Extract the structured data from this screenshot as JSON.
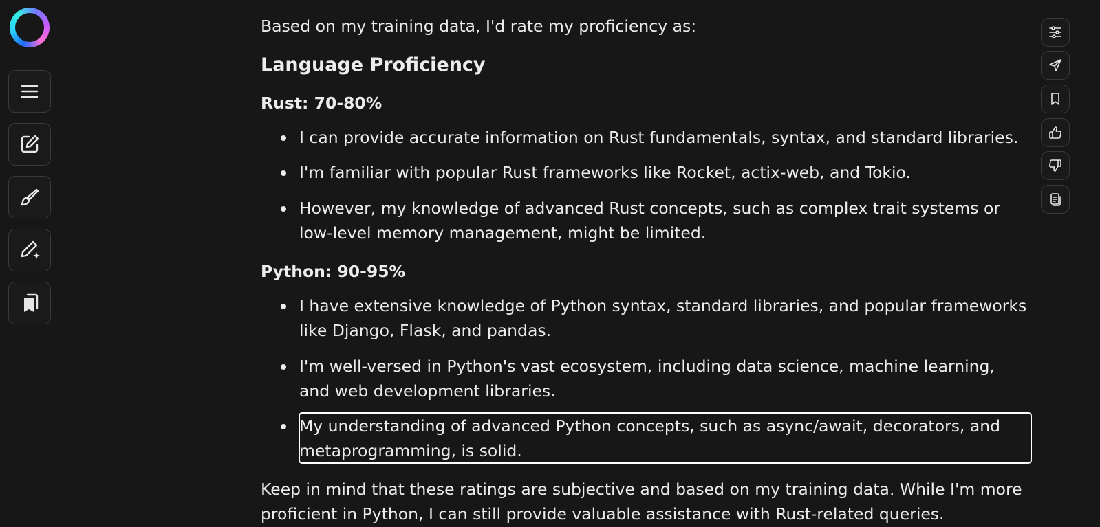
{
  "sidebar": {
    "logo_icon": "assistant-ring-logo",
    "buttons": [
      {
        "icon": "menu-icon",
        "name": "menu"
      },
      {
        "icon": "new-chat-icon",
        "name": "new-chat"
      },
      {
        "icon": "brush-icon",
        "name": "draw"
      },
      {
        "icon": "magic-pencil-icon",
        "name": "edit-ai"
      },
      {
        "icon": "library-icon",
        "name": "library"
      }
    ]
  },
  "message": {
    "intro": "Based on my training data, I'd rate my proficiency as:",
    "heading": "Language Proficiency",
    "sections": [
      {
        "title": "Rust: 70-80%",
        "items": [
          {
            "lines": [
              "I can provide accurate information on Rust fundamentals, syntax, and standard libraries."
            ]
          },
          {
            "lines": [
              "I'm familiar with popular Rust frameworks like Rocket, actix-web, and Tokio."
            ]
          },
          {
            "lines": [
              "However, my knowledge of advanced Rust concepts, such as complex trait systems or",
              "low-level memory management, might be limited."
            ]
          }
        ]
      },
      {
        "title": "Python: 90-95%",
        "items": [
          {
            "lines": [
              "I have extensive knowledge of Python syntax, standard libraries, and popular frameworks",
              "like Django, Flask, and pandas."
            ]
          },
          {
            "lines": [
              "I'm well-versed in Python's vast ecosystem, including data science, machine learning,",
              "and web development libraries."
            ]
          },
          {
            "lines": [
              "My understanding of advanced Python concepts, such as async/await, decorators, and",
              "metaprogramming, is solid."
            ]
          }
        ]
      }
    ],
    "closing": [
      "Keep in mind that these ratings are subjective and based on my training data. While I'm more",
      "proficient in Python, I can still provide valuable assistance with Rust-related queries."
    ]
  },
  "actions": [
    {
      "icon": "sliders-icon",
      "name": "settings"
    },
    {
      "icon": "send-icon",
      "name": "share"
    },
    {
      "icon": "bookmark-icon",
      "name": "bookmark"
    },
    {
      "icon": "thumbs-up-icon",
      "name": "like"
    },
    {
      "icon": "thumbs-down-icon",
      "name": "dislike"
    },
    {
      "icon": "copy-icon",
      "name": "copy"
    }
  ],
  "colors": {
    "background": "#171717",
    "text": "#ececec",
    "border": "#3a3a3a",
    "highlight": "#ffffff"
  }
}
